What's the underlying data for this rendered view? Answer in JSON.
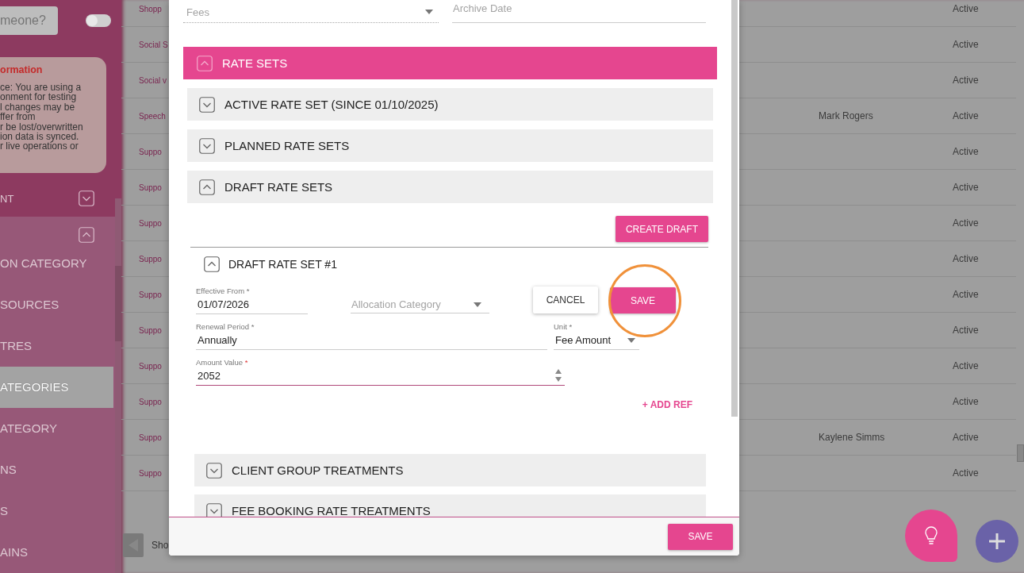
{
  "sidebar": {
    "search_button": "meone?",
    "toggle": {
      "on": false
    },
    "info_card": {
      "title": "ormation",
      "body": "ce: You are using a\nonment for testing\nl changes may be\nffer from\nr be lost/overwritten\nion data is synced.\nr live operations or"
    },
    "section": {
      "label": "NT",
      "expanded": false
    },
    "subsection": {
      "expanded": true
    },
    "items": [
      {
        "label": "ON CATEGORY",
        "selected": false
      },
      {
        "label": "SOURCES",
        "selected": false
      },
      {
        "label": "TRES",
        "selected": false
      },
      {
        "label": "ATEGORIES",
        "selected": true
      },
      {
        "label": "ATEGORY",
        "selected": false
      },
      {
        "label": "NS",
        "selected": false
      },
      {
        "label": "S",
        "selected": false
      },
      {
        "label": "AINS",
        "selected": false
      }
    ]
  },
  "table": {
    "rows": [
      {
        "column_1": "Shopp",
        "column_2": "",
        "status": "Active"
      },
      {
        "column_1": "Social S",
        "column_2": "",
        "status": "Active"
      },
      {
        "column_1": "Social v",
        "column_2": "",
        "status": "Active"
      },
      {
        "column_1": "Speech",
        "column_2": "Mark Rogers",
        "status": "Active"
      },
      {
        "column_1": "Suppo",
        "column_2": "",
        "status": "Active"
      },
      {
        "column_1": "Suppo",
        "column_2": "",
        "status": "Active"
      },
      {
        "column_1": "Suppo",
        "column_2": "",
        "status": "Active"
      },
      {
        "column_1": "Suppo",
        "column_2": "",
        "status": "Active"
      },
      {
        "column_1": "Suppo",
        "column_2": "",
        "status": "Active"
      },
      {
        "column_1": "Suppo",
        "column_2": "",
        "status": "Active"
      },
      {
        "column_1": "Suppo",
        "column_2": "",
        "status": "Active"
      },
      {
        "column_1": "Suppo",
        "column_2": "",
        "status": "Active"
      },
      {
        "column_1": "Suppo",
        "column_2": "Kaylene Simms",
        "status": "Active"
      },
      {
        "column_1": "Suppo",
        "column_2": "",
        "status": "Active"
      }
    ],
    "pager_text": "Sho"
  },
  "dialog": {
    "type_field": {
      "value": "Fees",
      "disabled": true
    },
    "archive_date": {
      "placeholder": "Archive Date"
    },
    "rate_sets": {
      "title": "RATE SETS",
      "expanded": true,
      "groups": [
        {
          "title": "ACTIVE RATE SET (SINCE 01/10/2025)",
          "expanded": false
        },
        {
          "title": "PLANNED RATE SETS",
          "expanded": false
        },
        {
          "title": "DRAFT RATE SETS",
          "expanded": true
        }
      ],
      "create_button": "CREATE DRAFT",
      "draft": {
        "title": "DRAFT RATE SET #1",
        "expanded": true,
        "effective_from": {
          "label": "Effective From",
          "mark": "*",
          "value": "01/07/2026"
        },
        "allocation_category": {
          "placeholder": "Allocation Category"
        },
        "cancel_button": "CANCEL",
        "save_button": "SAVE",
        "save_highlighted": true,
        "renewal_period": {
          "label": "Renewal Period",
          "mark": "*",
          "value": "Annually"
        },
        "unit": {
          "label": "Unit",
          "mark": "*",
          "value": "Fee Amount"
        },
        "amount_value": {
          "label": "Amount Value",
          "mark": "*",
          "mark_red": true,
          "value": "2052"
        },
        "add_ref": "+ ADD REF"
      }
    },
    "treatments": [
      {
        "title": "CLIENT GROUP TREATMENTS",
        "expanded": false
      },
      {
        "title": "FEE BOOKING RATE TREATMENTS",
        "expanded": false
      }
    ],
    "save_button": "SAVE"
  }
}
